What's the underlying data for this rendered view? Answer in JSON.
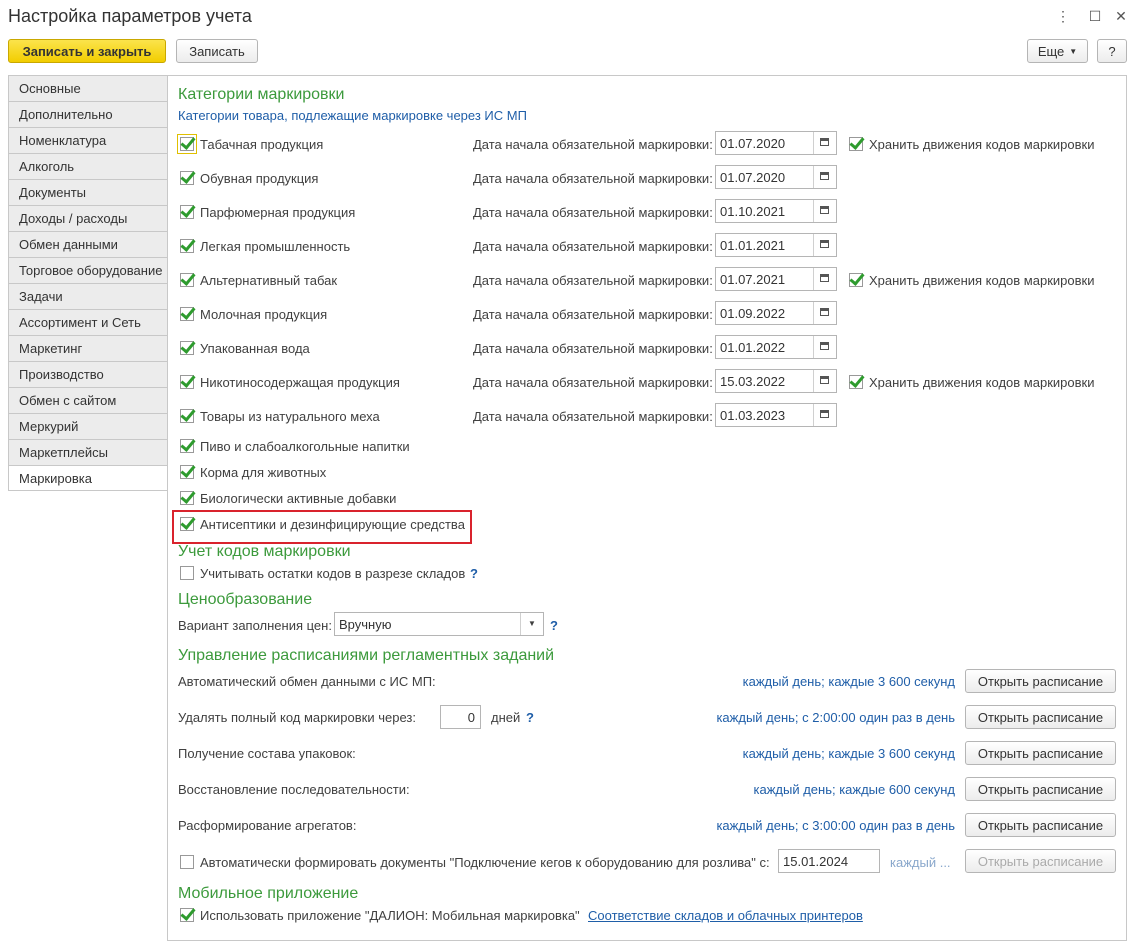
{
  "window": {
    "title": "Настройка параметров учета"
  },
  "toolbar": {
    "save_close": "Записать и закрыть",
    "save": "Записать",
    "more": "Еще",
    "help": "?"
  },
  "tabs": [
    "Основные",
    "Дополнительно",
    "Номенклатура",
    "Алкоголь",
    "Документы",
    "Доходы / расходы",
    "Обмен данными",
    "Торговое оборудование",
    "Задачи",
    "Ассортимент и Сеть",
    "Маркетинг",
    "Производство",
    "Обмен с сайтом",
    "Меркурий",
    "Маркетплейсы",
    "Маркировка"
  ],
  "active_tab": "Маркировка",
  "marking": {
    "title": "Категории маркировки",
    "hint": "Категории товара, подлежащие маркировке через ИС МП",
    "date_label": "Дата начала обязательной маркировки:",
    "store_label": "Хранить движения кодов маркировки",
    "categories": [
      {
        "name": "Табачная продукция",
        "checked": true,
        "date": "01.07.2020",
        "store": true
      },
      {
        "name": "Обувная продукция",
        "checked": true,
        "date": "01.07.2020"
      },
      {
        "name": "Парфюмерная продукция",
        "checked": true,
        "date": "01.10.2021"
      },
      {
        "name": "Легкая промышленность",
        "checked": true,
        "date": "01.01.2021"
      },
      {
        "name": "Альтернативный табак",
        "checked": true,
        "date": "01.07.2021",
        "store": true
      },
      {
        "name": "Молочная продукция",
        "checked": true,
        "date": "01.09.2022"
      },
      {
        "name": "Упакованная вода",
        "checked": true,
        "date": "01.01.2022"
      },
      {
        "name": "Никотиносодержащая продукция",
        "checked": true,
        "date": "15.03.2022",
        "store": true
      },
      {
        "name": "Товары из натурального меха",
        "checked": true,
        "date": "01.03.2023"
      },
      {
        "name": "Пиво и слабоалкогольные напитки",
        "checked": true
      },
      {
        "name": "Корма для животных",
        "checked": true
      },
      {
        "name": "Биологически активные добавки",
        "checked": true
      },
      {
        "name": "Антисептики и дезинфицирующие средства",
        "checked": true
      }
    ]
  },
  "codes": {
    "title": "Учет кодов маркировки",
    "warehouse_label": "Учитывать остатки кодов в разрезе складов",
    "help": "?"
  },
  "pricing": {
    "title": "Ценообразование",
    "label": "Вариант заполнения цен:",
    "value": "Вручную",
    "help": "?"
  },
  "schedule": {
    "title": "Управление расписаниями регламентных заданий",
    "open_label": "Открыть расписание",
    "rows": [
      {
        "label": "Автоматический обмен данными с ИС МП:",
        "link": "каждый день; каждые 3 600 секунд"
      },
      {
        "label": "Удалять полный код маркировки через:",
        "value": "0",
        "unit": "дней",
        "help": "?",
        "link": "каждый день; с 2:00:00 один раз в день"
      },
      {
        "label": "Получение состава упаковок:",
        "link": "каждый день; каждые 3 600 секунд"
      },
      {
        "label": "Восстановление последовательности:",
        "link": "каждый день; каждые 600 секунд"
      },
      {
        "label": "Расформирование агрегатов:",
        "link": "каждый день; с 3:00:00 один раз в день"
      }
    ],
    "kegs_label": "Автоматически формировать документы \"Подключение кегов к оборудованию для розлива\" с:",
    "kegs_date": "15.01.2024",
    "kegs_link": "каждый ..."
  },
  "mobile": {
    "title": "Мобильное приложение",
    "use_label": "Использовать приложение \"ДАЛИОН: Мобильная маркировка\"",
    "link": "Соответствие складов и облачных принтеров"
  }
}
